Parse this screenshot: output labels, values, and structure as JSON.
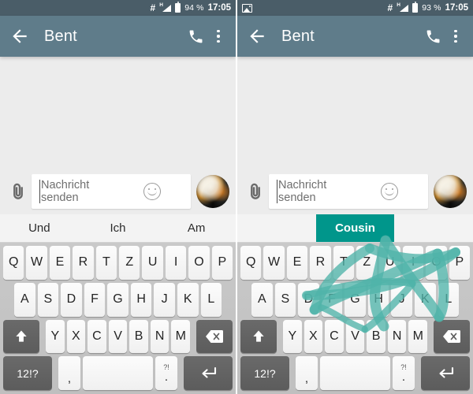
{
  "panels": [
    {
      "id": "left",
      "statusbar": {
        "left_icons": [],
        "vibrate_icon": "hash-icon",
        "signal_label": "H",
        "battery_label": "94 %",
        "time": "17:05"
      },
      "appbar": {
        "back": "back-arrow-icon",
        "title": "Bent",
        "call": "phone-icon",
        "overflow": "more-options-icon"
      },
      "composer": {
        "attach": "paperclip-icon",
        "placeholder_line1": "Nachricht",
        "placeholder_line2": "senden",
        "value": "",
        "emoji": "emoji-icon",
        "avatar": "contact-avatar"
      },
      "suggestions": [
        {
          "label": "Und",
          "highlighted": false
        },
        {
          "label": "Ich",
          "highlighted": false
        },
        {
          "label": "Am",
          "highlighted": false
        }
      ],
      "gesture": false
    },
    {
      "id": "right",
      "statusbar": {
        "left_icons": [
          "screenshot-image-icon"
        ],
        "vibrate_icon": "hash-icon",
        "signal_label": "H",
        "battery_label": "93 %",
        "time": "17:05"
      },
      "appbar": {
        "back": "back-arrow-icon",
        "title": "Bent",
        "call": "phone-icon",
        "overflow": "more-options-icon"
      },
      "composer": {
        "attach": "paperclip-icon",
        "placeholder_line1": "Nachricht",
        "placeholder_line2": "senden",
        "value": "",
        "emoji": "emoji-icon",
        "avatar": "contact-avatar"
      },
      "suggestions": [
        {
          "label": "",
          "highlighted": false
        },
        {
          "label": "Cousin",
          "highlighted": true
        },
        {
          "label": "",
          "highlighted": false
        }
      ],
      "gesture": true
    }
  ],
  "keyboard": {
    "row1": [
      "Q",
      "W",
      "E",
      "R",
      "T",
      "Z",
      "U",
      "I",
      "O",
      "P"
    ],
    "row2": [
      "A",
      "S",
      "D",
      "F",
      "G",
      "H",
      "J",
      "K",
      "L"
    ],
    "row3": [
      "Y",
      "X",
      "C",
      "V",
      "B",
      "N",
      "M"
    ],
    "shift_icon": "shift-arrow-icon",
    "backspace_icon": "backspace-icon",
    "symbols_label": "12!?",
    "comma_label": ",",
    "space_label": "",
    "period_upper": "?!",
    "period_lower": ".",
    "enter_icon": "enter-arrow-icon"
  },
  "colors": {
    "statusbar": "#4A5D68",
    "appbar": "#5F7C8A",
    "chat_background": "#ECECEC",
    "accent_teal": "#00968B",
    "gesture_trail": "#4FB3A9",
    "keyboard_background": "#C4C4C4",
    "key_face": "#F7F7F7",
    "key_function": "#616161"
  }
}
